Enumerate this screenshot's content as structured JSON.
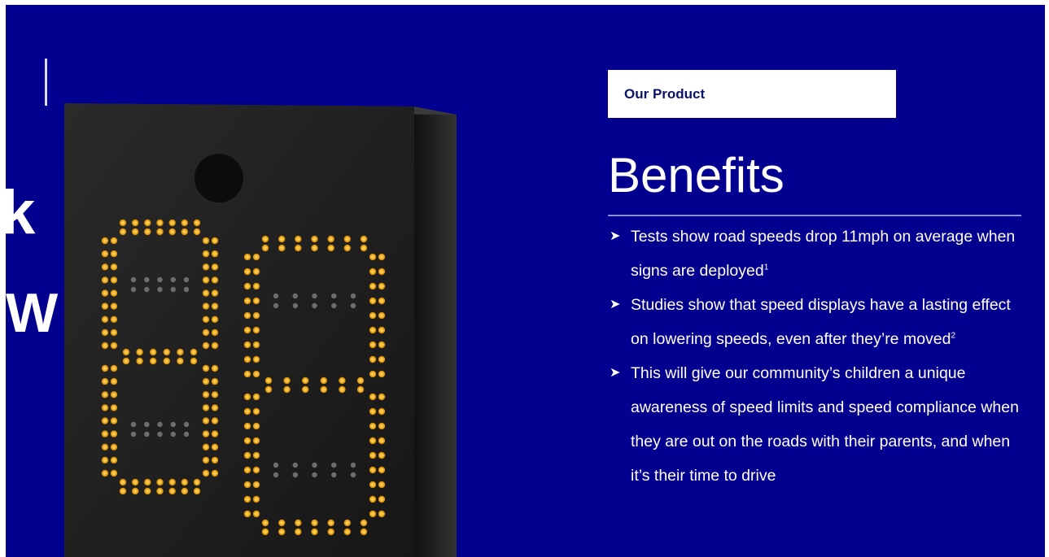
{
  "left_fragments": [
    "k",
    "W"
  ],
  "product_tag": "Our Product",
  "title": "Benefits",
  "sign": {
    "digits": [
      "8",
      "8"
    ],
    "led_color": "#f0b020",
    "housing_color": "#1e1e1e"
  },
  "benefits": [
    {
      "text": "Tests show road speeds drop 11mph on average when signs are deployed",
      "note": "1"
    },
    {
      "text": "Studies show that speed displays have a lasting effect on lowering speeds, even after they’re moved",
      "note": "2"
    },
    {
      "text": "This will give our community’s children a unique awareness of speed limits and speed compliance when they are out on the roads with their parents, and when it’s their time to drive",
      "note": ""
    }
  ],
  "colors": {
    "background": "#03008f",
    "tag_text": "#0b1368"
  }
}
